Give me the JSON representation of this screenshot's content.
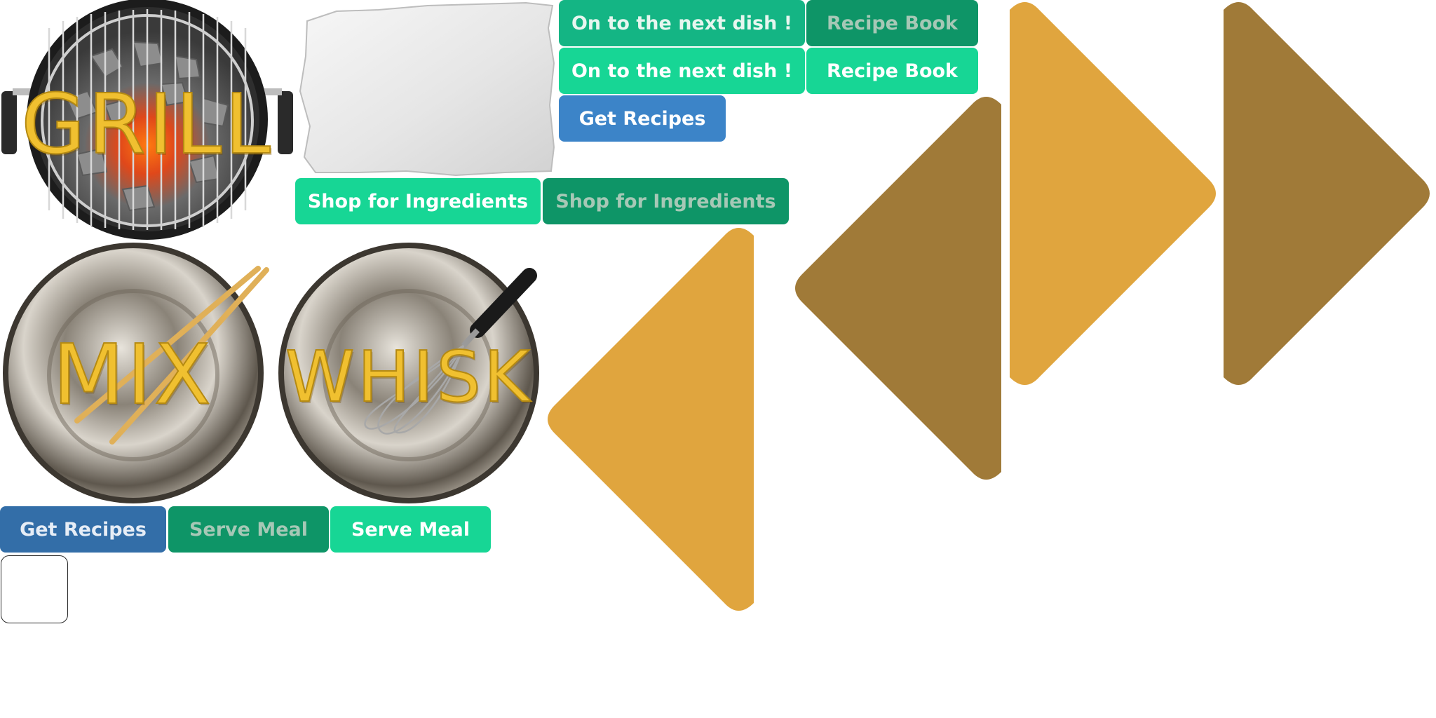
{
  "tiles": {
    "grill": {
      "label": "GRILL"
    },
    "mix": {
      "label": "MIX"
    },
    "whisk": {
      "label": "WHISK"
    }
  },
  "buttons": {
    "next_dish_pressed": "On to the next dish !",
    "next_dish_normal": "On to the next dish !",
    "recipe_book_disabled": "Recipe Book",
    "recipe_book_normal": "Recipe Book",
    "get_recipes_normal": "Get Recipes",
    "get_recipes_pressed": "Get Recipes",
    "shop_normal": "Shop for Ingredients",
    "shop_disabled": "Shop for Ingredients",
    "serve_disabled": "Serve Meal",
    "serve_normal": "Serve Meal"
  },
  "icons": {
    "grill": "grill-icon",
    "paper": "torn-paper-icon",
    "mix": "bowl-chopsticks-icon",
    "whisk": "bowl-whisk-icon",
    "arrow_left_gold": "arrow-left-icon",
    "arrow_left_brown": "arrow-left-icon",
    "arrow_right_gold": "arrow-right-icon",
    "arrow_right_brown": "arrow-right-icon"
  },
  "colors": {
    "teal_mid": "#14b584",
    "teal_dark": "#0e9567",
    "teal_light": "#17d695",
    "blue": "#3c84c8",
    "blue_dark": "#336ea8",
    "arrow_gold": "#e0a53e",
    "arrow_brown": "#a07a38",
    "label_yellow": "#f0c030"
  }
}
